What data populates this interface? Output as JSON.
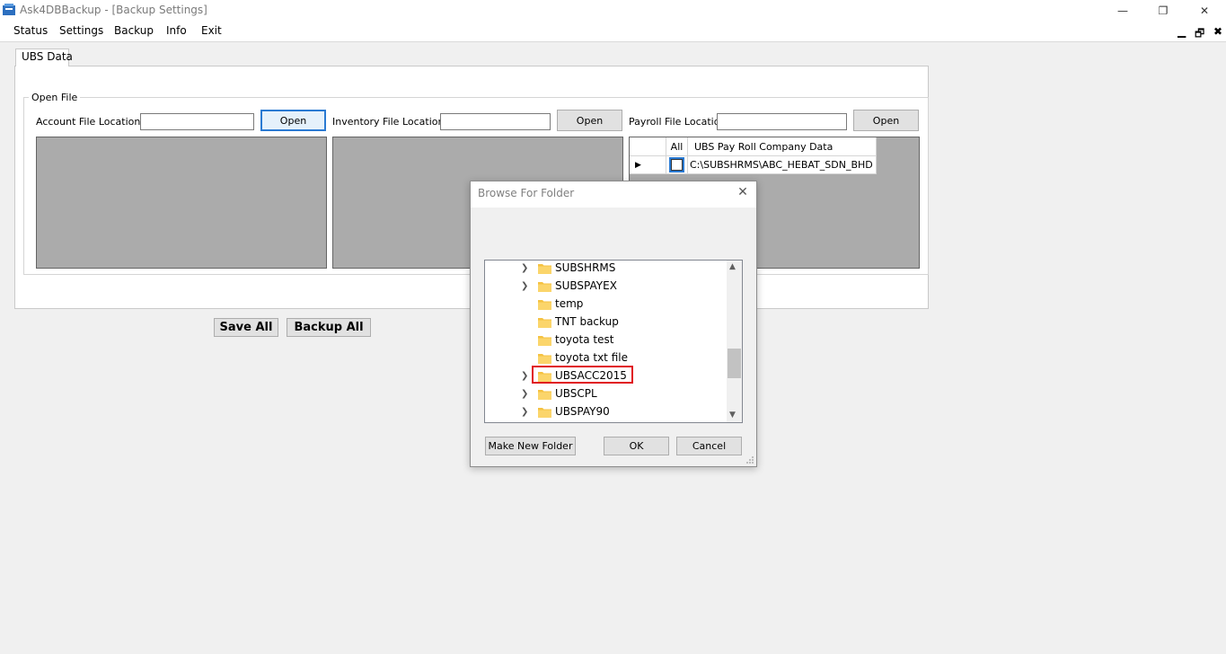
{
  "window": {
    "title": "Ask4DBBackup - [Backup Settings]",
    "min_glyph": "—",
    "restore_glyph": "❐",
    "close_glyph": "✕"
  },
  "menu": {
    "items": [
      "Status",
      "Settings",
      "Backup",
      "Info",
      "Exit"
    ],
    "mdi_min": "▁",
    "mdi_restore": "🗗",
    "mdi_close": "✖"
  },
  "tab": {
    "label": "UBS Data"
  },
  "open_file": {
    "legend": "Open File",
    "account_label": "Account File  Location",
    "account_value": "",
    "inventory_label": "Inventory File  Location",
    "inventory_value": "",
    "payroll_label": "Payroll File  Location",
    "payroll_value": "",
    "open_label": "Open"
  },
  "payroll_grid": {
    "col_all": "All",
    "col_data": "UBS Pay Roll Company Data",
    "row_indicator": "▶",
    "row_path": "C:\\SUBSHRMS\\ABC_HEBAT_SDN_BHD",
    "row_checked": false
  },
  "actions": {
    "save_all": "Save All",
    "backup_all": "Backup All"
  },
  "dialog": {
    "title": "Browse For Folder",
    "close_glyph": "✕",
    "folders": [
      {
        "name": "SUBSHRMS",
        "expandable": true
      },
      {
        "name": "SUBSPAYEX",
        "expandable": true
      },
      {
        "name": "temp",
        "expandable": false
      },
      {
        "name": "TNT backup",
        "expandable": false
      },
      {
        "name": "toyota test",
        "expandable": false
      },
      {
        "name": "toyota txt file",
        "expandable": false
      },
      {
        "name": "UBSACC2015",
        "expandable": true,
        "highlighted": true
      },
      {
        "name": "UBSCPL",
        "expandable": true
      },
      {
        "name": "UBSPAY90",
        "expandable": true
      }
    ],
    "chevron_glyph": "❯",
    "scroll_up": "▲",
    "scroll_down": "▼",
    "make_new_folder": "Make New Folder",
    "ok": "OK",
    "cancel": "Cancel",
    "colors": {
      "highlight": "#e0141e",
      "folder": "#f5c242"
    }
  }
}
